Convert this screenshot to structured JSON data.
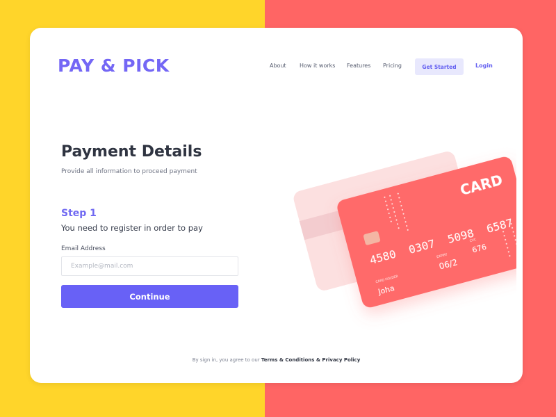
{
  "brand": {
    "logo": "PAY & PICK",
    "accent": "#7467f5"
  },
  "background": {
    "left_color": "#ffd52a",
    "right_color": "#ff6564"
  },
  "nav": {
    "about": "About",
    "how_it_works": "How it works",
    "features": "Features",
    "pricing": "Pricing",
    "get_started": "Get Started",
    "login": "Login"
  },
  "form": {
    "title": "Payment Details",
    "subtitle": "Provide all information to proceed payment",
    "step_label": "Step 1",
    "step_text": "You need to register in order to pay",
    "email_label": "Email Address",
    "email_placeholder": "Example@mail.com",
    "email_value": "",
    "continue_label": "Continue",
    "button_color": "#6861f6"
  },
  "footer": {
    "prefix": "By sign in, you agree to our",
    "terms": "Terms & Conditions & Privacy Policy"
  },
  "card": {
    "brand": "CARD",
    "number": [
      "4580",
      "0307",
      "5098",
      "6587"
    ],
    "holder_label": "CARD HOLDER",
    "holder_value": "Joha",
    "expiry_label": "EXPIRY",
    "expiry_value": "06/2",
    "cvc_label": "CVC",
    "cvc_value": "676",
    "color": "#ff6b6a",
    "chip_icon": "chip-icon"
  }
}
